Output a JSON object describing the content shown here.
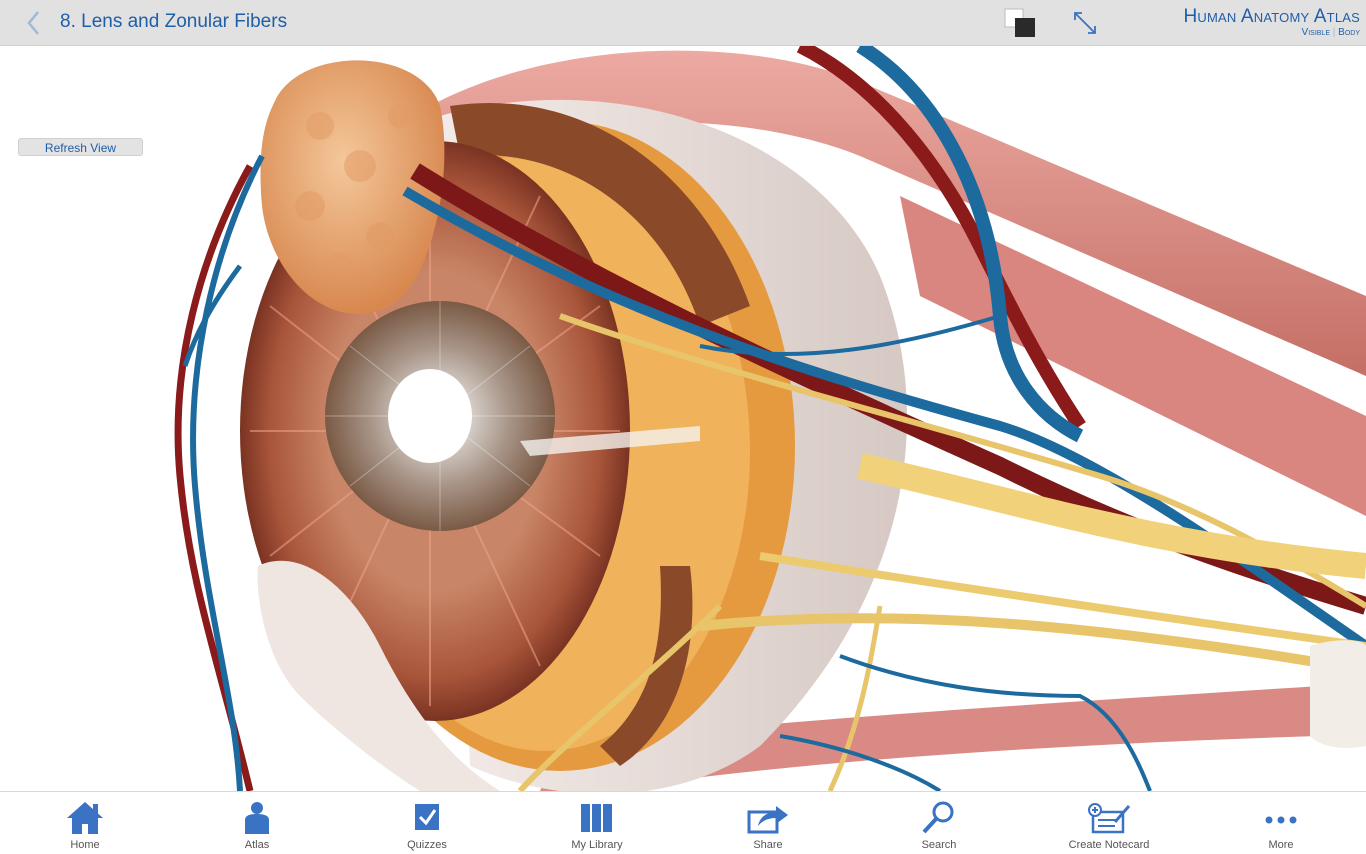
{
  "header": {
    "title": "8. Lens and Zonular Fibers",
    "brand": "Human Anatomy Atlas",
    "brand_sub_left": "Visible",
    "brand_sub_right": "Body"
  },
  "viewer": {
    "refresh_label": "Refresh View"
  },
  "tabs": {
    "home": "Home",
    "atlas": "Atlas",
    "quizzes": "Quizzes",
    "my_library": "My Library",
    "share": "Share",
    "search": "Search",
    "create_notecard": "Create Notecard",
    "more": "More"
  },
  "colors": {
    "accent": "#1f5fa8",
    "icon_blue": "#3a72c4",
    "header_bg": "#e1e1e1"
  }
}
